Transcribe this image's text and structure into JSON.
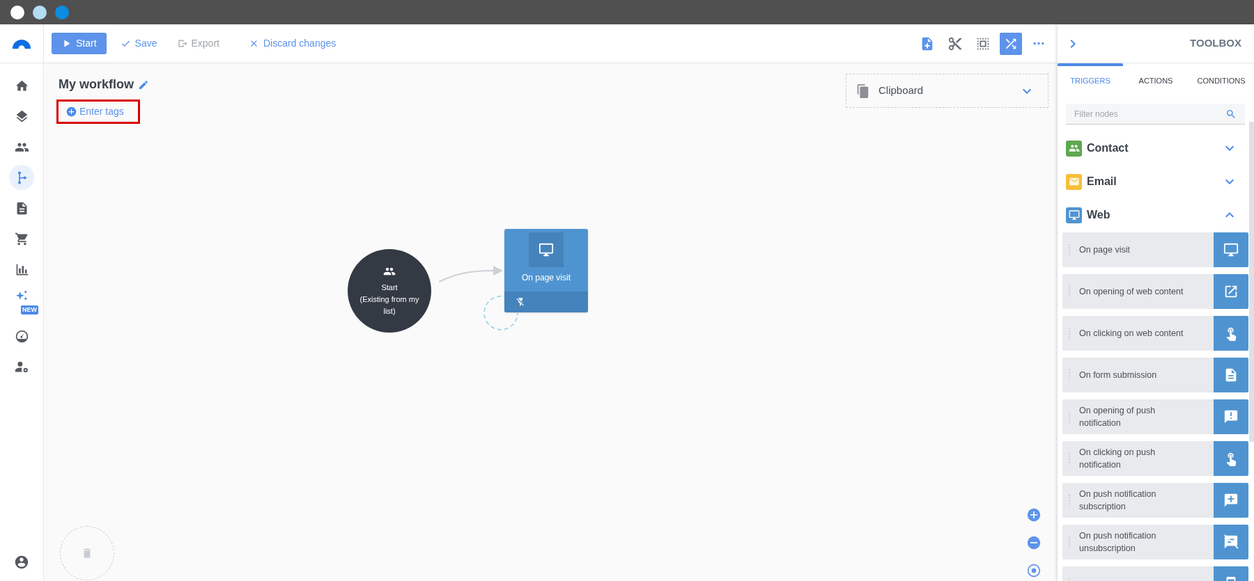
{
  "window": {
    "title_dots": [
      {
        "color": "#ffffff"
      },
      {
        "color": "#b3dcf5"
      },
      {
        "color": "#0b8ce0"
      }
    ]
  },
  "sidebar": {
    "items": [
      {
        "selected": false
      },
      {
        "selected": false
      },
      {
        "selected": false
      },
      {
        "selected": true
      },
      {
        "selected": false
      },
      {
        "selected": false
      },
      {
        "selected": false
      },
      {
        "selected": false,
        "badge": "NEW"
      },
      {
        "selected": false
      },
      {
        "selected": false
      }
    ]
  },
  "toolbar": {
    "actions": [
      {
        "label": "Start",
        "kind": "primary",
        "disabled": false
      },
      {
        "label": "Save",
        "kind": "link",
        "disabled": false
      },
      {
        "label": "Export",
        "kind": "link",
        "disabled": true
      },
      {
        "label": "Discard changes",
        "kind": "link",
        "disabled": false
      }
    ],
    "tools": [
      {
        "selected": false
      },
      {
        "selected": false
      },
      {
        "selected": false
      },
      {
        "selected": true
      },
      {
        "selected": false
      }
    ]
  },
  "workflow": {
    "title": "My workflow",
    "tags_link": "Enter tags",
    "tags_highlighted": true
  },
  "clipboard": {
    "label": "Clipboard",
    "expanded": false
  },
  "canvas": {
    "start_node": {
      "label": "Start",
      "sublabel": "(Existing from my list)"
    },
    "trigger_node": {
      "label": "On page visit"
    }
  },
  "toolbox": {
    "title": "TOOLBOX",
    "tabs": [
      {
        "label": "TRIGGERS",
        "selected": true
      },
      {
        "label": "ACTIONS",
        "selected": false
      },
      {
        "label": "CONDITIONS",
        "selected": false
      }
    ],
    "search": {
      "placeholder": "Filter nodes"
    },
    "categories": [
      {
        "label": "Contact",
        "color": "#5fa84f",
        "expanded": false
      },
      {
        "label": "Email",
        "color": "#f6bf3a",
        "expanded": false
      },
      {
        "label": "Web",
        "color": "#4f94d1",
        "expanded": true,
        "items": [
          {
            "kind": "node",
            "label": "On page visit"
          },
          {
            "kind": "node",
            "label": "On opening of web content"
          },
          {
            "kind": "node",
            "label": "On clicking on web content"
          },
          {
            "kind": "node",
            "label": "On form submission"
          },
          {
            "kind": "node",
            "label": "On opening of push notification"
          },
          {
            "kind": "node",
            "label": "On clicking on push notification"
          },
          {
            "kind": "node",
            "label": "On push notification subscription"
          },
          {
            "kind": "node",
            "label": "On push notification unsubscription"
          },
          {
            "kind": "clipped"
          }
        ]
      }
    ]
  }
}
